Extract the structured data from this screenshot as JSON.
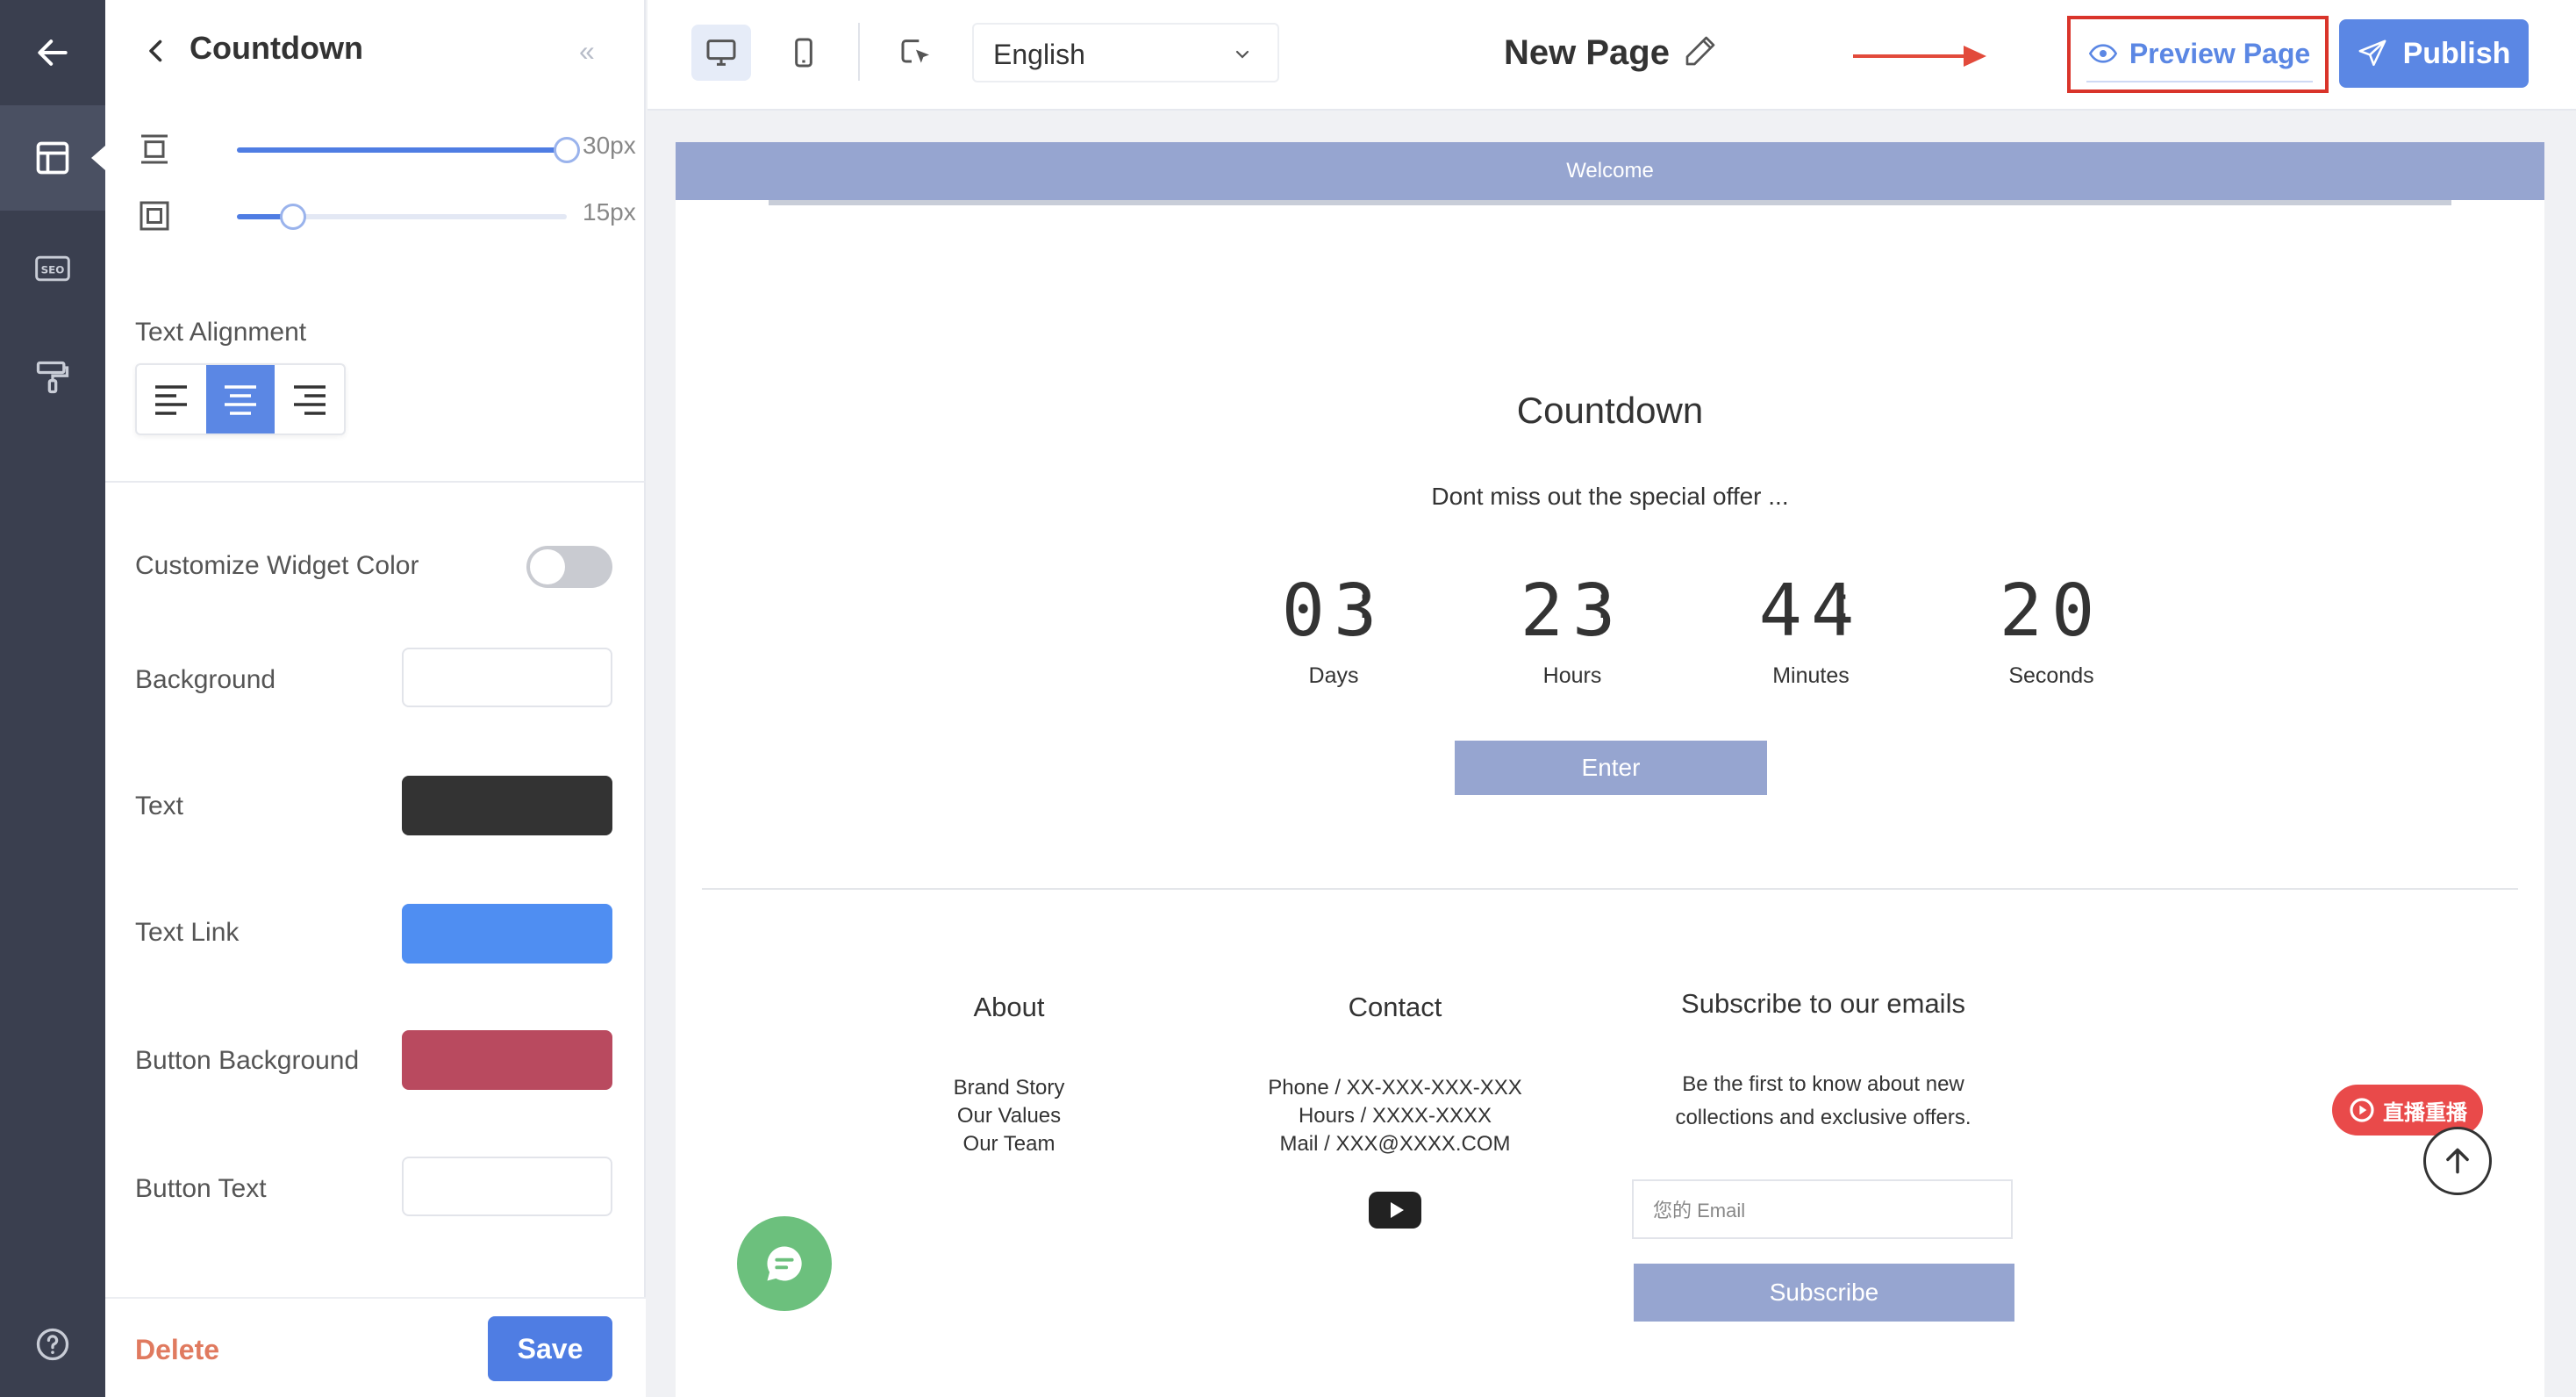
{
  "panel": {
    "title": "Countdown",
    "sliders": [
      {
        "value_label": "30px",
        "level": 1.0
      },
      {
        "value_label": "15px",
        "level": 0.17
      }
    ],
    "text_alignment_label": "Text Alignment",
    "alignment_options": [
      "left",
      "center",
      "right"
    ],
    "alignment_selected": "center",
    "customize_label": "Customize Widget Color",
    "customize_enabled": false,
    "colors": [
      {
        "label": "Background",
        "hex": "#ffffff"
      },
      {
        "label": "Text",
        "hex": "#333333"
      },
      {
        "label": "Text Link",
        "hex": "#4f8ef2"
      },
      {
        "label": "Button Background",
        "hex": "#b94a5f"
      },
      {
        "label": "Button Text",
        "hex": "#ffffff"
      }
    ],
    "delete_label": "Delete",
    "save_label": "Save"
  },
  "topbar": {
    "language": "English",
    "page_name": "New Page",
    "preview_label": "Preview Page",
    "publish_label": "Publish"
  },
  "canvas": {
    "welcome": "Welcome",
    "countdown": {
      "title": "Countdown",
      "subtitle": "Dont miss out the special offer ...",
      "units": [
        {
          "value": "03",
          "label": "Days"
        },
        {
          "value": "23",
          "label": "Hours"
        },
        {
          "value": "44",
          "label": "Minutes"
        },
        {
          "value": "20",
          "label": "Seconds"
        }
      ],
      "separator": ":",
      "enter_label": "Enter"
    },
    "footer": {
      "about": {
        "heading": "About",
        "links": [
          "Brand Story",
          "Our Values",
          "Our Team"
        ]
      },
      "contact": {
        "heading": "Contact",
        "lines": [
          "Phone / XX-XXX-XXX-XXX",
          "Hours / XXXX-XXXX",
          "Mail / XXX@XXXX.COM"
        ]
      },
      "subscribe": {
        "heading": "Subscribe to our emails",
        "text_line1": "Be the first to know about new",
        "text_line2": "collections and exclusive offers.",
        "email_placeholder": "您的 Email",
        "button_label": "Subscribe"
      }
    },
    "live_badge": "直播重播"
  },
  "accent_color": "#5b87e4"
}
